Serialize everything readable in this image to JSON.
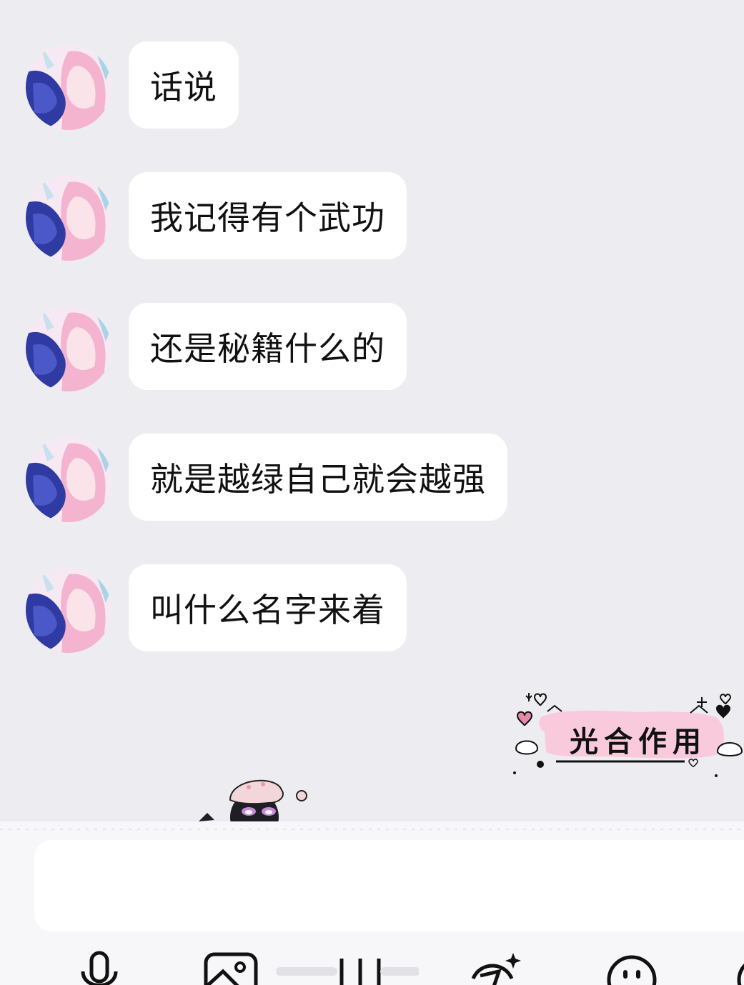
{
  "messages": [
    {
      "text": "话说"
    },
    {
      "text": "我记得有个武功"
    },
    {
      "text": "还是秘籍什么的"
    },
    {
      "text": "就是越绿自己就会越强"
    },
    {
      "text": "叫什么名字来着"
    }
  ],
  "sticker": {
    "text": "光合作用"
  },
  "input": {
    "value": ""
  },
  "toolbar": {
    "icons": [
      "microphone-icon",
      "image-icon",
      "voice-wave-icon",
      "magic-edit-icon",
      "emoji-icon",
      "plus-icon"
    ]
  },
  "colors": {
    "background": "#ededf1",
    "bubble": "#ffffff",
    "sticker_pink": "#f9c9dc",
    "text": "#111111"
  }
}
